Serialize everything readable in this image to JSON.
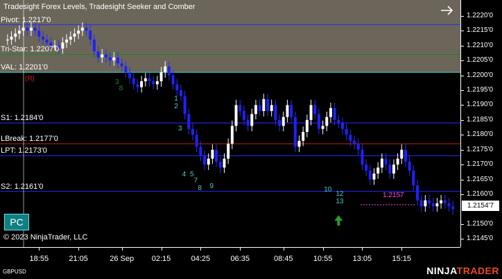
{
  "title": "Tradesight Forex Levels, Tradesight Seeker and Comber",
  "symbol": "GBPUSD",
  "copyright": "© 2023 NinjaTrader, LLC",
  "pc_button": "PC",
  "brand": {
    "main": "NINJA",
    "accent": "TRADER"
  },
  "levels": [
    {
      "label": "Pivot: 1.2217'0",
      "price": 1.2217,
      "color": "#2a2aff"
    },
    {
      "label": "Tri-Star: 1.2207'0",
      "price": 1.2207,
      "color": "#1a8a1a"
    },
    {
      "label": "VAL: 1.2201'0",
      "price": 1.2201,
      "color": "#3ad0d0"
    },
    {
      "label": "S1: 1.2184'0",
      "price": 1.2184,
      "color": "#2a2aff"
    },
    {
      "label": "LBreak: 1.2177'0",
      "price": 1.2177,
      "color": "#d02020"
    },
    {
      "label": "LPT: 1.2173'0",
      "price": 1.2173,
      "color": "#2a2aff"
    },
    {
      "label": "S2: 1.2161'0",
      "price": 1.2161,
      "color": "#2a2aff"
    }
  ],
  "marker_r": "(R)",
  "current_price": "1.2154'7",
  "magenta_label": "1.2157",
  "y_ticks": [
    "1.2220'0",
    "1.2215'0",
    "1.2210'0",
    "1.2205'0",
    "1.2200'0",
    "1.2195'0",
    "1.2190'0",
    "1.2185'0",
    "1.2180'0",
    "1.2175'0",
    "1.2170'0",
    "1.2165'0",
    "1.2160'0",
    "1.2150'0",
    "1.2145'0"
  ],
  "y_tick_values": [
    1.222,
    1.2215,
    1.221,
    1.2205,
    1.22,
    1.2195,
    1.219,
    1.2185,
    1.218,
    1.2175,
    1.217,
    1.2165,
    1.216,
    1.215,
    1.2145
  ],
  "x_ticks": [
    "18:55",
    "21:05",
    "26 Sep",
    "02:15",
    "04:25",
    "06:35",
    "08:45",
    "10:55",
    "13:05",
    "15:15"
  ],
  "x_tick_index": [
    8,
    18,
    29,
    39,
    49,
    59,
    70,
    80,
    90,
    100
  ],
  "count_marks": [
    {
      "text": "3",
      "i": 28,
      "p": 1.21975,
      "color": "#1a8a1a"
    },
    {
      "text": "8",
      "i": 29,
      "p": 1.21955,
      "color": "#1a8a1a"
    },
    {
      "text": "1",
      "i": 43,
      "p": 1.2192,
      "color": "#3ad0d0"
    },
    {
      "text": "2",
      "i": 43,
      "p": 1.21895,
      "color": "#3ad0d0"
    },
    {
      "text": "3",
      "i": 44,
      "p": 1.2182,
      "color": "#3ad0d0"
    },
    {
      "text": "4",
      "i": 45,
      "p": 1.21665,
      "color": "#3ad0d0"
    },
    {
      "text": "5",
      "i": 47,
      "p": 1.21665,
      "color": "#3ad0d0"
    },
    {
      "text": "7",
      "i": 48,
      "p": 1.21645,
      "color": "#3ad0d0"
    },
    {
      "text": "8",
      "i": 49,
      "p": 1.2162,
      "color": "#3ad0d0"
    },
    {
      "text": "9",
      "i": 52,
      "p": 1.21625,
      "color": "#3ad0d0"
    },
    {
      "text": "10",
      "i": 81,
      "p": 1.21615,
      "color": "#3ad0d0"
    },
    {
      "text": "12",
      "i": 84,
      "p": 1.216,
      "color": "#3ad0d0"
    },
    {
      "text": "13",
      "i": 84,
      "p": 1.21575,
      "color": "#3ad0d0"
    }
  ],
  "chart_data": {
    "type": "candlestick",
    "y_range": [
      1.21423,
      1.22253
    ],
    "shaded_above": 1.2201,
    "series": [
      1.2212,
      1.2213,
      1.2214,
      1.2215,
      1.2216,
      1.2215,
      1.2216,
      1.2215,
      1.2213,
      1.2212,
      1.2211,
      1.221,
      1.221,
      1.2209,
      1.2211,
      1.2212,
      1.2213,
      1.2214,
      1.2215,
      1.2216,
      1.2215,
      1.2212,
      1.2208,
      1.2206,
      1.2207,
      1.2206,
      1.2205,
      1.2206,
      1.2204,
      1.2203,
      1.2201,
      1.2199,
      1.2197,
      1.2196,
      1.2198,
      1.2199,
      1.2198,
      1.2197,
      1.2198,
      1.2201,
      1.2203,
      1.22,
      1.2197,
      1.2195,
      1.2193,
      1.2187,
      1.2182,
      1.218,
      1.2176,
      1.2173,
      1.217,
      1.2172,
      1.2175,
      1.2171,
      1.2169,
      1.2172,
      1.2177,
      1.2183,
      1.219,
      1.2188,
      1.2185,
      1.2183,
      1.2187,
      1.219,
      1.2188,
      1.2192,
      1.2188,
      1.219,
      1.2185,
      1.2183,
      1.2186,
      1.219,
      1.2186,
      1.2176,
      1.2178,
      1.2181,
      1.2185,
      1.219,
      1.2187,
      1.2182,
      1.2183,
      1.2186,
      1.2189,
      1.2185,
      1.2184,
      1.2182,
      1.218,
      1.2178,
      1.2177,
      1.2175,
      1.217,
      1.2168,
      1.2165,
      1.2167,
      1.2169,
      1.2172,
      1.217,
      1.2167,
      1.217,
      1.2172,
      1.2175,
      1.2171,
      1.2168,
      1.2163,
      1.2158,
      1.2156,
      1.2158,
      1.2157,
      1.2156,
      1.2157,
      1.2158,
      1.2157,
      1.2156,
      1.2155
    ]
  }
}
